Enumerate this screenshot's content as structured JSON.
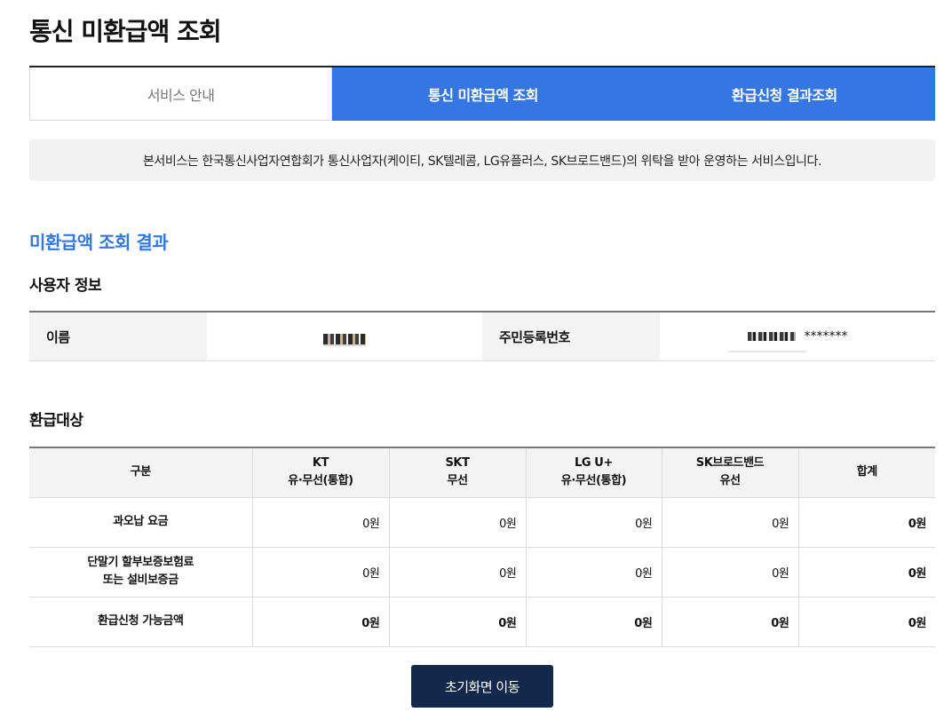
{
  "page_title": "통신 미환급액 조회",
  "tabs": [
    {
      "label": "서비스 안내",
      "active": false
    },
    {
      "label": "통신 미환급액 조회",
      "active": true
    },
    {
      "label": "환급신청 결과조회",
      "active": true
    }
  ],
  "notice": "본서비스는 한국통신사업자연합회가 통신사업자(케이티, SK텔레콤, LG유플러스, SK브로드밴드)의 위탁을 받아 운영하는 서비스입니다.",
  "result_section_title": "미환급액 조회 결과",
  "user_info": {
    "title": "사용자 정보",
    "name_label": "이름",
    "id_label": "주민등록번호",
    "id_masked_suffix": "*******"
  },
  "refund": {
    "title": "환급대상",
    "headers": [
      {
        "line1": "구분",
        "line2": ""
      },
      {
        "line1": "KT",
        "line2": "유·무선(통합)"
      },
      {
        "line1": "SKT",
        "line2": "무선"
      },
      {
        "line1": "LG U+",
        "line2": "유·무선(통합)"
      },
      {
        "line1": "SK브로드밴드",
        "line2": "유선"
      },
      {
        "line1": "합계",
        "line2": ""
      }
    ],
    "rows": [
      {
        "label1": "과오납 요금",
        "label2": "",
        "values": [
          "0원",
          "0원",
          "0원",
          "0원",
          "0원"
        ]
      },
      {
        "label1": "단말기 할부보증보험료",
        "label2": "또는 설비보증금",
        "values": [
          "0원",
          "0원",
          "0원",
          "0원",
          "0원"
        ]
      },
      {
        "label1": "환급신청 가능금액",
        "label2": "",
        "values": [
          "0원",
          "0원",
          "0원",
          "0원",
          "0원"
        ]
      }
    ]
  },
  "home_button_label": "초기화면 이동",
  "colors": {
    "accent_blue": "#3576e2",
    "navy_button": "#13294b",
    "notice_bg": "#f2f2f2",
    "header_bg": "#f3f3f3"
  }
}
